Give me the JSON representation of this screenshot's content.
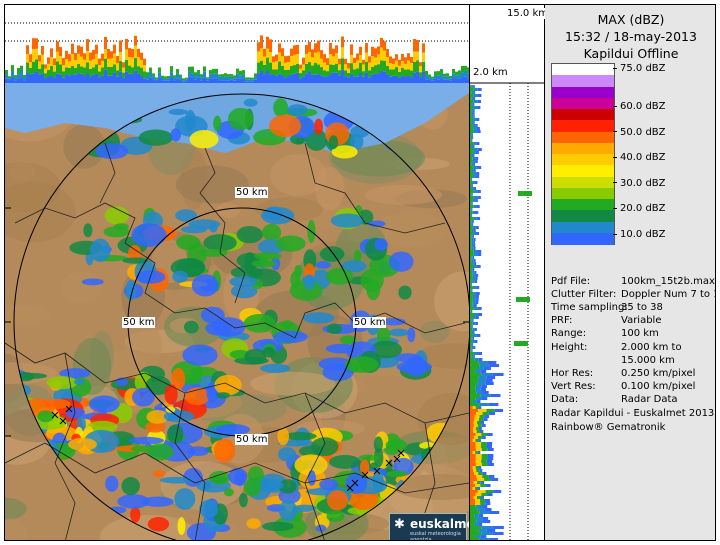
{
  "product": {
    "title": "MAX (dBZ)",
    "datetime": "15:32 / 18-may-2013",
    "radar_status": "Kapildui Offline"
  },
  "height_labels": {
    "top": "15.0 km",
    "bottom": "2.0 km"
  },
  "range_rings": {
    "north": "50 km",
    "west": "50 km",
    "east": "50 km",
    "south": "50 km"
  },
  "legend": {
    "levels": [
      {
        "label": "75.0 dBZ",
        "value": 75
      },
      {
        "label": "60.0 dBZ",
        "value": 60
      },
      {
        "label": "50.0 dBZ",
        "value": 50
      },
      {
        "label": "40.0 dBZ",
        "value": 40
      },
      {
        "label": "30.0 dBZ",
        "value": 30
      },
      {
        "label": "20.0 dBZ",
        "value": 20
      },
      {
        "label": "10.0 dBZ",
        "value": 10
      }
    ],
    "colors": [
      "#ffffff",
      "#cc88ff",
      "#9900cc",
      "#cc0099",
      "#cc0000",
      "#ff2200",
      "#ff6600",
      "#ffaa00",
      "#ffcc00",
      "#ffee00",
      "#ccdd00",
      "#88cc00",
      "#22aa22",
      "#118844",
      "#2288cc",
      "#3366ff"
    ]
  },
  "info": [
    {
      "key": "Pdf File:",
      "value": "100km_15t2b.max"
    },
    {
      "key": "Clutter Filter:",
      "value": "Doppler Num 7 to 11"
    },
    {
      "key": "Time sampling:",
      "value": "35 to 38"
    },
    {
      "key": "PRF:",
      "value": "Variable"
    },
    {
      "key": "Range:",
      "value": "100 km"
    },
    {
      "key": "Height:",
      "value": "2.000 km to"
    },
    {
      "key": "",
      "value": "15.000 km"
    },
    {
      "key": "Hor Res:",
      "value": "0.250 km/pixel"
    },
    {
      "key": "Vert Res:",
      "value": "0.100 km/pixel"
    },
    {
      "key": "Data:",
      "value": "Radar Data"
    }
  ],
  "credits": {
    "line1": "Radar Kapildui - Euskalmet 2013",
    "line2": "Rainbow® Gematronik"
  },
  "logo": {
    "name": "euskalmet",
    "tagline": "euskal meteorologia agentzia",
    "icon": "euskalmet-logo-icon"
  }
}
